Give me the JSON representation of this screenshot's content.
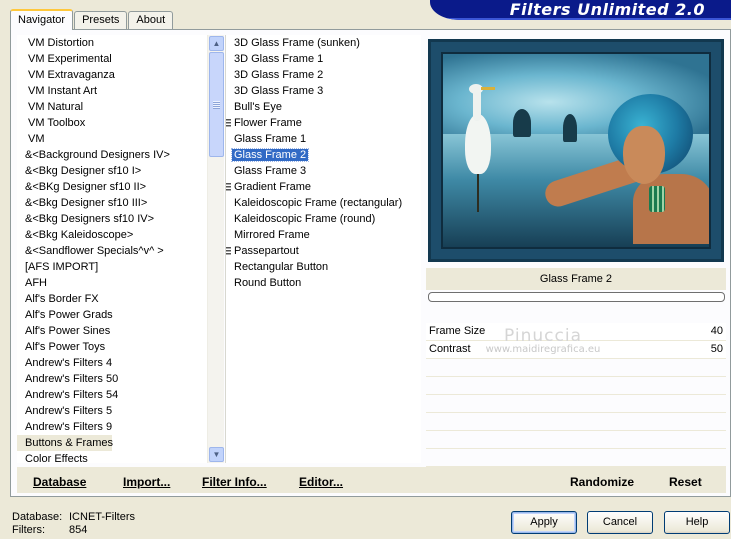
{
  "brand": {
    "title": "Filters Unlimited 2.0"
  },
  "tabs": [
    {
      "label": "Navigator",
      "active": true
    },
    {
      "label": "Presets",
      "active": false
    },
    {
      "label": "About",
      "active": false
    }
  ],
  "categories": {
    "items": [
      "VM Distortion",
      "VM Experimental",
      "VM Extravaganza",
      "VM Instant Art",
      "VM Natural",
      "VM Toolbox",
      "VM",
      "&<Background Designers IV>",
      "&<Bkg Designer sf10 I>",
      "&<BKg Designer sf10 II>",
      "&<Bkg Designer sf10 III>",
      "&<Bkg Designers sf10 IV>",
      "&<Bkg Kaleidoscope>",
      "&<Sandflower Specials^v^ >",
      "[AFS IMPORT]",
      "AFH",
      "Alf's Border FX",
      "Alf's Power Grads",
      "Alf's Power Sines",
      "Alf's Power Toys",
      "Andrew's Filters 4",
      "Andrew's Filters 50",
      "Andrew's Filters 54",
      "Andrew's Filters 5",
      "Andrew's Filters 9",
      "Buttons & Frames",
      "Color Effects"
    ],
    "selected_index": 25
  },
  "filters": {
    "items": [
      {
        "label": "3D Glass Frame (sunken)",
        "group": false
      },
      {
        "label": "3D Glass Frame 1",
        "group": false
      },
      {
        "label": "3D Glass Frame 2",
        "group": false
      },
      {
        "label": "3D Glass Frame 3",
        "group": false
      },
      {
        "label": "Bull's Eye",
        "group": false
      },
      {
        "label": "Flower Frame",
        "group": true
      },
      {
        "label": "Glass Frame 1",
        "group": false
      },
      {
        "label": "Glass Frame 2",
        "group": false
      },
      {
        "label": "Glass Frame 3",
        "group": false
      },
      {
        "label": "Gradient Frame",
        "group": true
      },
      {
        "label": "Kaleidoscopic Frame (rectangular)",
        "group": false
      },
      {
        "label": "Kaleidoscopic Frame (round)",
        "group": false
      },
      {
        "label": "Mirrored Frame",
        "group": false
      },
      {
        "label": "Passepartout",
        "group": true
      },
      {
        "label": "Rectangular Button",
        "group": false
      },
      {
        "label": "Round Button",
        "group": false
      }
    ],
    "selected_index": 7
  },
  "preview": {
    "title": "Glass Frame 2",
    "progress": 0
  },
  "params": [
    {
      "label": "Frame Size",
      "value": "40"
    },
    {
      "label": "Contrast",
      "value": "50"
    }
  ],
  "watermark": {
    "main": "Pinuccia",
    "sub": "www.maidiregrafica.eu"
  },
  "panel_buttons": {
    "database": "Database",
    "import": "Import...",
    "filter_info": "Filter Info...",
    "editor": "Editor...",
    "randomize": "Randomize",
    "reset": "Reset"
  },
  "footer": {
    "database_label": "Database:",
    "database_value": "ICNET-Filters",
    "filters_label": "Filters:",
    "filters_value": "854"
  },
  "dialog_buttons": {
    "apply": "Apply",
    "cancel": "Cancel",
    "help": "Help"
  }
}
